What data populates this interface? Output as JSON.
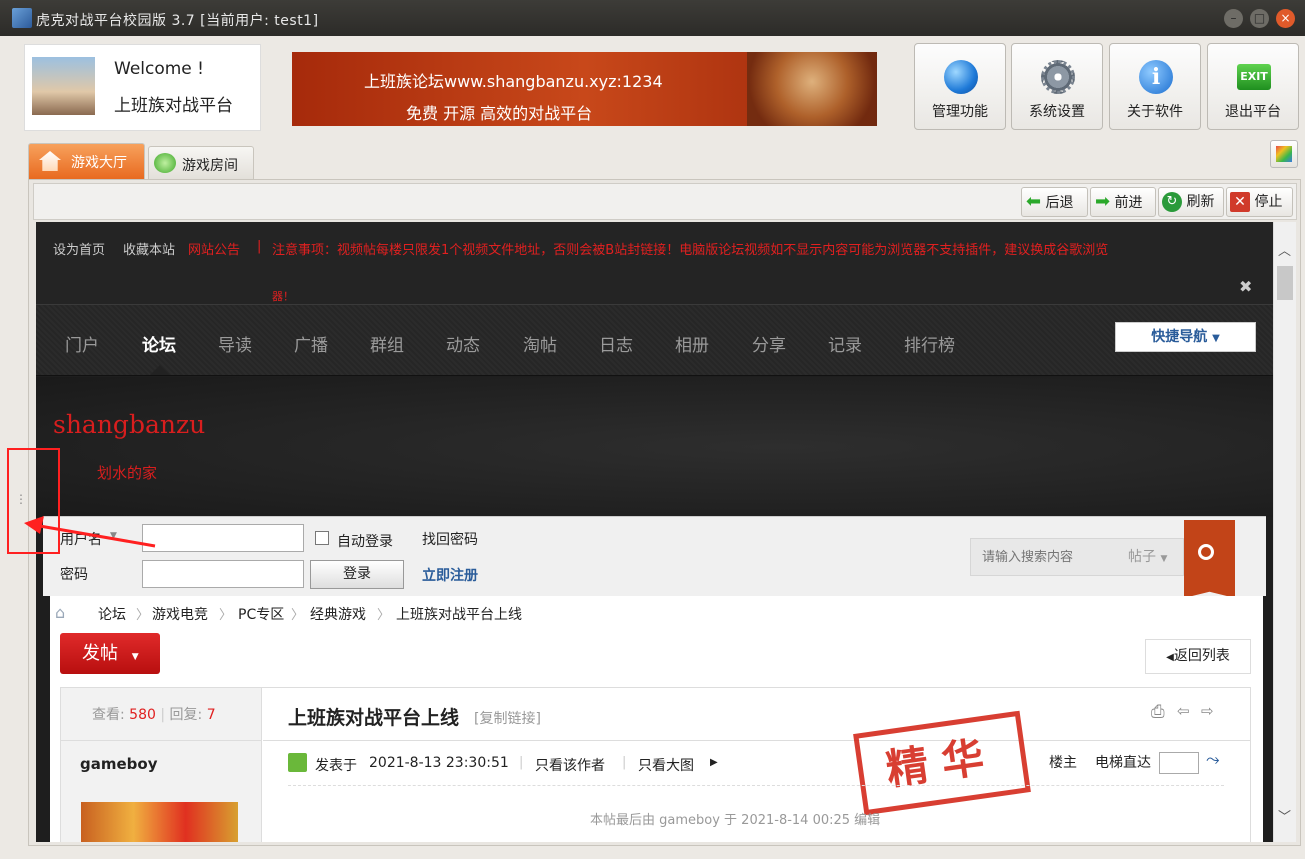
{
  "window": {
    "title": "虎克对战平台校园版 3.7 [当前用户: test1]"
  },
  "header": {
    "welcome": "Welcome !",
    "subtitle": "上班族对战平台",
    "banner_line1": "上班族论坛www.shangbanzu.xyz:1234",
    "banner_line2": "免费 开源 高效的对战平台",
    "buttons": [
      {
        "label": "管理功能",
        "icon": "globe-icon"
      },
      {
        "label": "系统设置",
        "icon": "gear-icon"
      },
      {
        "label": "关于软件",
        "icon": "info-icon"
      },
      {
        "label": "退出平台",
        "icon": "exit-icon",
        "icon_text": "EXIT"
      }
    ]
  },
  "tabs": [
    {
      "label": "游戏大厅",
      "active": true
    },
    {
      "label": "游戏房间",
      "active": false
    }
  ],
  "browser": {
    "back": "后退",
    "forward": "前进",
    "refresh": "刷新",
    "stop": "停止"
  },
  "site": {
    "topbar": {
      "set_home": "设为首页",
      "bookmark": "收藏本站",
      "notice_label": "网站公告",
      "separator": "|",
      "notice_text": "注意事项：视频帖每楼只限发1个视频文件地址，否则会被B站封链接！电脑版论坛视频如不显示内容可能为浏览器不支持插件，建议换成谷歌浏览",
      "notice_wrap": "器！"
    },
    "nav": [
      "门户",
      "论坛",
      "导读",
      "广播",
      "群组",
      "动态",
      "淘帖",
      "日志",
      "相册",
      "分享",
      "记录",
      "排行榜"
    ],
    "nav_active": 1,
    "quick_nav": "快捷导航",
    "site_name": "shangbanzu",
    "slogan": "划水的家",
    "login": {
      "username_label": "用户名",
      "password_label": "密码",
      "auto_login": "自动登录",
      "find_password": "找回密码",
      "login_button": "登录",
      "register": "立即注册"
    },
    "search": {
      "placeholder": "请输入搜索内容",
      "type": "帖子"
    },
    "breadcrumb": [
      "论坛",
      "游戏电竞",
      "PC专区",
      "经典游戏",
      "上班族对战平台上线"
    ],
    "post_button": "发帖",
    "back_to_list": "返回列表",
    "thread": {
      "views_label": "查看:",
      "views": "580",
      "replies_label": "回复:",
      "replies": "7",
      "title": "上班族对战平台上线",
      "copy_link": "[复制链接]",
      "author": "gameboy",
      "posted_prefix": "发表于",
      "posted_time": "2021-8-13 23:30:51",
      "only_author": "只看该作者",
      "only_big_image": "只看大图",
      "floor": "楼主",
      "elevator": "电梯直达",
      "stamp": "精华",
      "edit_note": "本帖最后由 gameboy 于 2021-8-14 00:25 编辑"
    }
  },
  "colors": {
    "accent_red": "#e02020",
    "link_blue": "#2a5c9a",
    "stamp_red": "#d42a1c"
  }
}
